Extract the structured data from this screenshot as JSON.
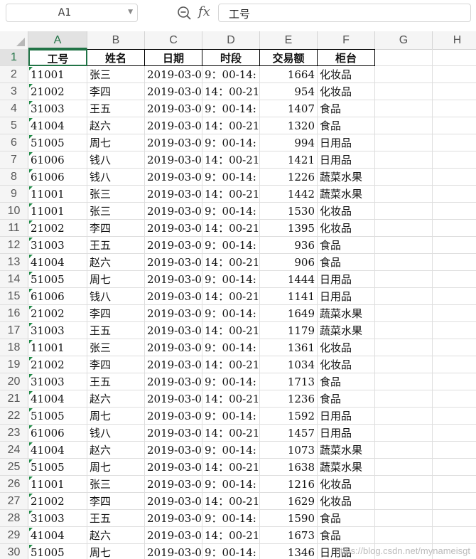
{
  "namebox": {
    "value": "A1"
  },
  "formula": {
    "fx_label": "fx",
    "value": "工号"
  },
  "columns": [
    "A",
    "B",
    "C",
    "D",
    "E",
    "F",
    "G",
    "H"
  ],
  "sheet": {
    "headers": [
      "工号",
      "姓名",
      "日期",
      "时段",
      "交易额",
      "柜台"
    ],
    "rows": [
      [
        "11001",
        "张三",
        "2019-03-0",
        "9：00-14:",
        "1664",
        "化妆品"
      ],
      [
        "21002",
        "李四",
        "2019-03-0",
        "14：00-21",
        "954",
        "化妆品"
      ],
      [
        "31003",
        "王五",
        "2019-03-0",
        "9：00-14:",
        "1407",
        "食品"
      ],
      [
        "41004",
        "赵六",
        "2019-03-0",
        "14：00-21",
        "1320",
        "食品"
      ],
      [
        "51005",
        "周七",
        "2019-03-0",
        "9：00-14:",
        "994",
        "日用品"
      ],
      [
        "61006",
        "钱八",
        "2019-03-0",
        "14：00-21",
        "1421",
        "日用品"
      ],
      [
        "61006",
        "钱八",
        "2019-03-0",
        "9：00-14:",
        "1226",
        "蔬菜水果"
      ],
      [
        "11001",
        "张三",
        "2019-03-0",
        "14：00-21",
        "1442",
        "蔬菜水果"
      ],
      [
        "11001",
        "张三",
        "2019-03-0",
        "9：00-14:",
        "1530",
        "化妆品"
      ],
      [
        "21002",
        "李四",
        "2019-03-0",
        "14：00-21",
        "1395",
        "化妆品"
      ],
      [
        "31003",
        "王五",
        "2019-03-0",
        "9：00-14:",
        "936",
        "食品"
      ],
      [
        "41004",
        "赵六",
        "2019-03-0",
        "14：00-21",
        "906",
        "食品"
      ],
      [
        "51005",
        "周七",
        "2019-03-0",
        "9：00-14:",
        "1444",
        "日用品"
      ],
      [
        "61006",
        "钱八",
        "2019-03-0",
        "14：00-21",
        "1141",
        "日用品"
      ],
      [
        "21002",
        "李四",
        "2019-03-0",
        "9：00-14:",
        "1649",
        "蔬菜水果"
      ],
      [
        "31003",
        "王五",
        "2019-03-0",
        "14：00-21",
        "1179",
        "蔬菜水果"
      ],
      [
        "11001",
        "张三",
        "2019-03-0",
        "9：00-14:",
        "1361",
        "化妆品"
      ],
      [
        "21002",
        "李四",
        "2019-03-0",
        "14：00-21",
        "1034",
        "化妆品"
      ],
      [
        "31003",
        "王五",
        "2019-03-0",
        "9：00-14:",
        "1713",
        "食品"
      ],
      [
        "41004",
        "赵六",
        "2019-03-0",
        "14：00-21",
        "1236",
        "食品"
      ],
      [
        "51005",
        "周七",
        "2019-03-0",
        "9：00-14:",
        "1592",
        "日用品"
      ],
      [
        "61006",
        "钱八",
        "2019-03-0",
        "14：00-21",
        "1457",
        "日用品"
      ],
      [
        "41004",
        "赵六",
        "2019-03-0",
        "9：00-14:",
        "1073",
        "蔬菜水果"
      ],
      [
        "51005",
        "周七",
        "2019-03-0",
        "14：00-21",
        "1638",
        "蔬菜水果"
      ],
      [
        "11001",
        "张三",
        "2019-03-0",
        "9：00-14:",
        "1216",
        "化妆品"
      ],
      [
        "21002",
        "李四",
        "2019-03-0",
        "14：00-21",
        "1629",
        "化妆品"
      ],
      [
        "31003",
        "王五",
        "2019-03-0",
        "9：00-14:",
        "1590",
        "食品"
      ],
      [
        "41004",
        "赵六",
        "2019-03-0",
        "14：00-21",
        "1673",
        "食品"
      ],
      [
        "51005",
        "周七",
        "2019-03-0",
        "9：00-14:",
        "1346",
        "日用品"
      ]
    ]
  },
  "watermark": "https://blog.csdn.net/mynameisgt",
  "colors": {
    "accent": "#217346",
    "gridline": "#dedede",
    "header_bg": "#f5f5f5"
  }
}
